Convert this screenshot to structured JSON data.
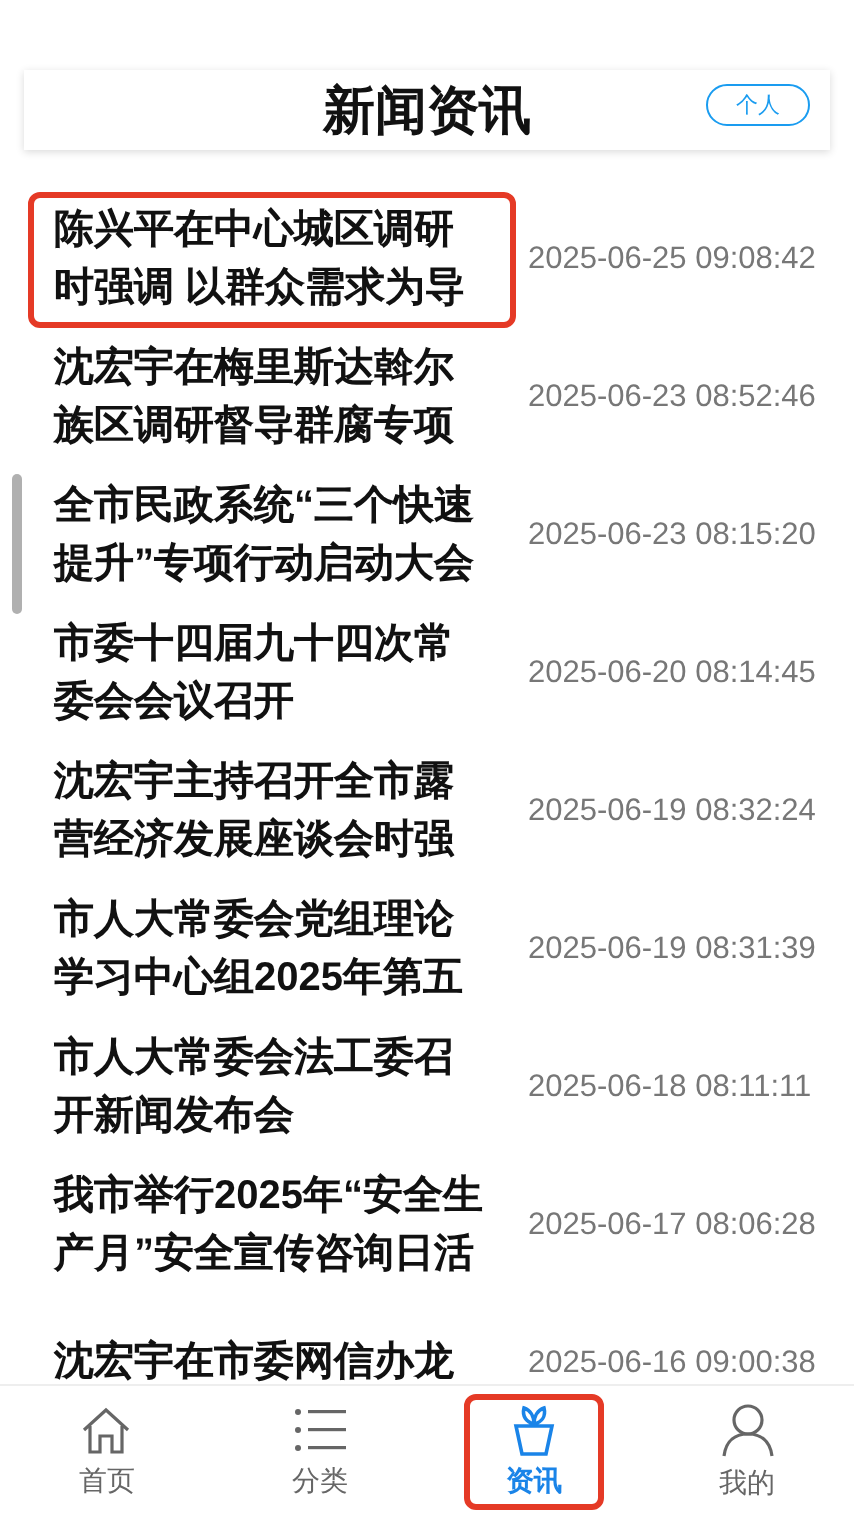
{
  "header": {
    "title": "新闻资讯",
    "action": "个人"
  },
  "articles": [
    {
      "title": "陈兴平在中心城区调研时强调 以群众需求为导",
      "date": "2025-06-25 09:08:42",
      "highlighted": true
    },
    {
      "title": "沈宏宇在梅里斯达斡尔族区调研督导群腐专项",
      "date": "2025-06-23 08:52:46",
      "highlighted": false
    },
    {
      "title": "全市民政系统“三个快速提升”专项行动启动大会",
      "date": "2025-06-23 08:15:20",
      "highlighted": false
    },
    {
      "title": "市委十四届九十四次常委会会议召开",
      "date": "2025-06-20 08:14:45",
      "highlighted": false
    },
    {
      "title": "沈宏宇主持召开全市露营经济发展座谈会时强",
      "date": "2025-06-19 08:32:24",
      "highlighted": false
    },
    {
      "title": "市人大常委会党组理论学习中心组2025年第五",
      "date": "2025-06-19 08:31:39",
      "highlighted": false
    },
    {
      "title": "市人大常委会法工委召开新闻发布会",
      "date": "2025-06-18 08:11:11",
      "highlighted": false
    },
    {
      "title": "我市举行2025年“安全生产月”安全宣传咨询日活",
      "date": "2025-06-17 08:06:28",
      "highlighted": false
    },
    {
      "title": "沈宏宇在市委网信办龙",
      "date": "2025-06-16 09:00:38",
      "highlighted": false
    }
  ],
  "tabs": [
    {
      "kind": "home",
      "label": "首页",
      "selected": false,
      "highlighted": false
    },
    {
      "kind": "list",
      "label": "分类",
      "selected": false,
      "highlighted": false
    },
    {
      "kind": "plant",
      "label": "资讯",
      "selected": true,
      "highlighted": true
    },
    {
      "kind": "person",
      "label": "我的",
      "selected": false,
      "highlighted": false
    }
  ]
}
